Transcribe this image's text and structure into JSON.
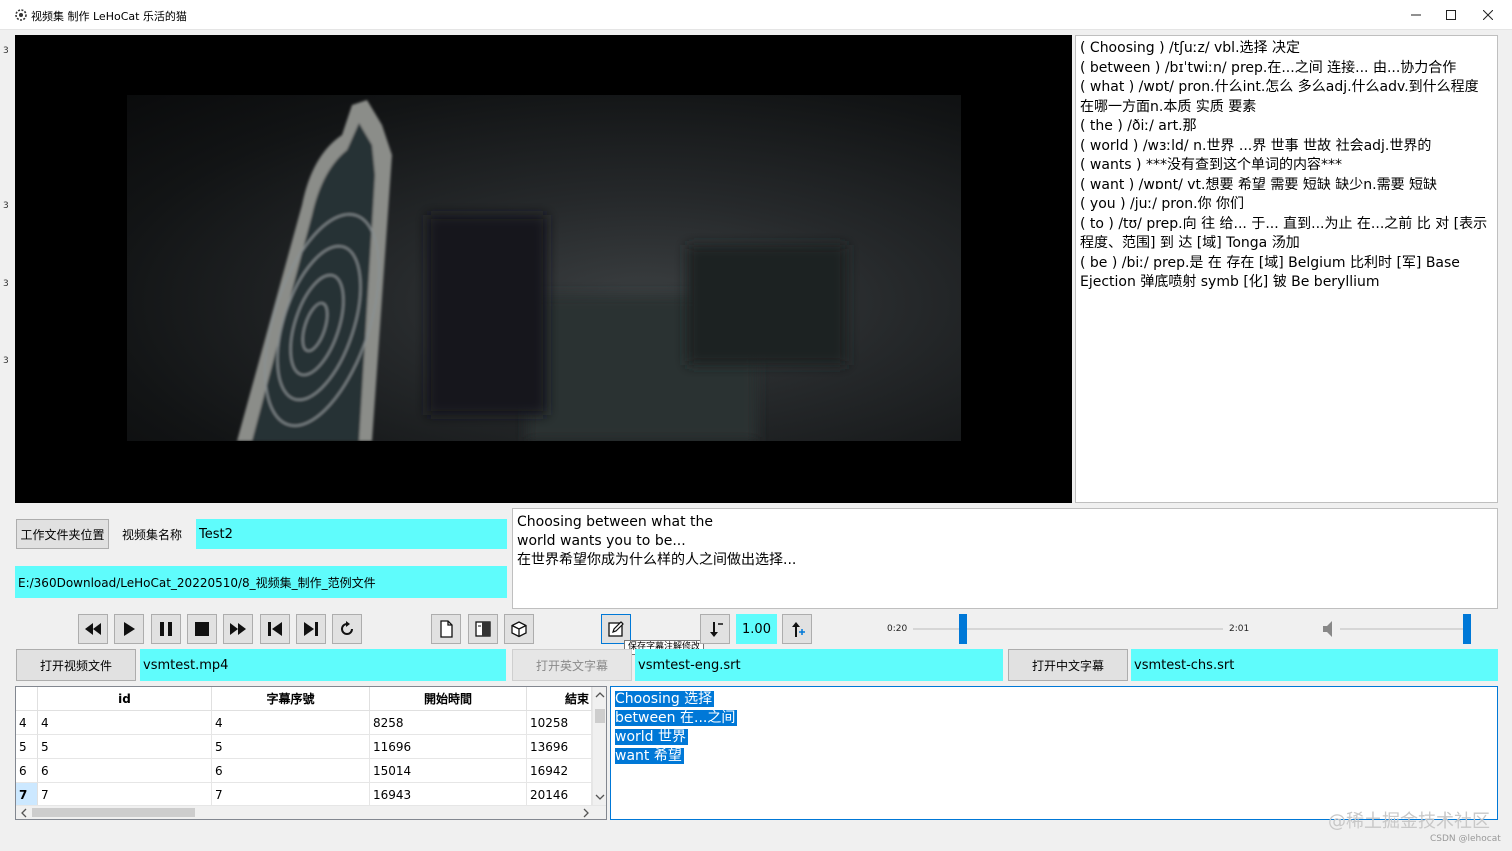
{
  "window": {
    "title": "视频集 制作  LeHoCat 乐活的猫"
  },
  "edge_ticks": [
    "3",
    "3",
    "3",
    "3"
  ],
  "dictionary": {
    "lines": [
      "( Choosing ) /tʃuːz/  vbl.选择 决定",
      "( between ) /bɪˈtwiːn/   prep.在...之间 连接... 由...协力合作",
      "( what ) /wɒt/   pron.什么int.怎么 多么adj.什么adv.到什么程度 在哪一方面n.本质 实质 要素",
      "( the ) /ðiː/   art.那",
      "( world ) /wɜːld/  n.世界 ...界 世事 世故 社会adj.世界的",
      "( wants )  ***没有查到这个单词的内容***",
      "( want ) /wɒnt/  vt.想要 希望 需要 短缺 缺少n.需要 短缺",
      "( you ) /juː/    pron.你 你们",
      "( to ) /tʊ/   prep.向 往 给... 于... 直到...为止 在...之前 比 对 [表示程度、范围] 到 达 [域] Tonga  汤加",
      "( be ) /biː/   prep.是 在 存在 [域] Belgium  比利时 [军] Base Ejection 弹底喷射 symb [化] 铍 Be beryllium"
    ]
  },
  "workspace": {
    "folder_button": "工作文件夹位置",
    "name_label": "视频集名称",
    "name_value": "Test2",
    "path_value": "E:/360Download/LeHoCat_20220510/8_视频集_制作_范例文件"
  },
  "subtitle": {
    "line1": "Choosing between what the",
    "line2": "world wants you to be...",
    "line3": "在世界希望你成为什么样的人之间做出选择..."
  },
  "controls": {
    "tooltip": "保存字幕注解修改",
    "speed": "1.00",
    "time_start": "0:20",
    "time_end": "2:01",
    "progress_fraction": 0.16,
    "volume_fraction": 1.0
  },
  "files": {
    "open_video_button": "打开视频文件",
    "video_file": "vsmtest.mp4",
    "open_en_button": "打开英文字幕",
    "en_file": "vsmtest-eng.srt",
    "open_cn_button": "打开中文字幕",
    "cn_file": "vsmtest-chs.srt"
  },
  "table": {
    "columns": [
      "id",
      "字幕序號",
      "開始時間",
      "結束"
    ],
    "rows": [
      {
        "row": "4",
        "id": "4",
        "seq": "4",
        "start": "8258",
        "end": "10258"
      },
      {
        "row": "5",
        "id": "5",
        "seq": "5",
        "start": "11696",
        "end": "13696"
      },
      {
        "row": "6",
        "id": "6",
        "seq": "6",
        "start": "15014",
        "end": "16942"
      },
      {
        "row": "7",
        "id": "7",
        "seq": "7",
        "start": "16943",
        "end": "20146"
      }
    ],
    "selected_row": "7"
  },
  "words": [
    "Choosing 选择",
    "between 在...之间",
    "world 世界",
    "want 希望"
  ],
  "watermark": "@稀土掘金技术社区",
  "credit": "CSDN @lehocat",
  "colors": {
    "accent": "#0078d7",
    "cyan_field": "#5ffcfc",
    "video_bg": "#000000"
  }
}
